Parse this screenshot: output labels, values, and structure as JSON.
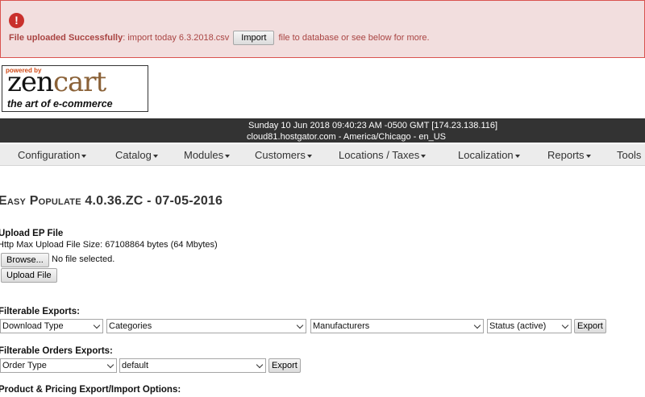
{
  "alert": {
    "bold": "File uploaded Successfully",
    "mid": ": import today 6.3.2018.csv",
    "button": "Import",
    "tail": "file to database or see below for more.",
    "icon": "exclamation-circle-icon",
    "color": "#a94442"
  },
  "logo": {
    "powered": "powered by",
    "zen": "zen",
    "cart": "cart",
    "tagline": "the art of e-commerce"
  },
  "header": {
    "datetime": "Sunday 10 Jun 2018 09:40:23 AM -0500 GMT [174.23.138.116]",
    "server": "cloud81.hostgator.com - America/Chicago - en_US"
  },
  "nav": [
    "Configuration",
    "Catalog",
    "Modules",
    "Customers",
    "Locations / Taxes",
    "Localization",
    "Reports",
    "Tools"
  ],
  "page": {
    "title": "Easy Populate 4.0.36.ZC - 07-05-2016",
    "upload_heading": "Upload EP File",
    "max_size": "Http Max Upload File Size: 67108864 bytes (64 Mbytes)",
    "browse": "Browse...",
    "no_file": "No file selected.",
    "upload_button": "Upload File"
  },
  "filterable_exports": {
    "label": "Filterable Exports:",
    "selects": [
      "Download Type",
      "Categories",
      "Manufacturers",
      "Status (active)"
    ],
    "button": "Export"
  },
  "orders_exports": {
    "label": "Filterable Orders Exports:",
    "selects": [
      "Order Type",
      "default"
    ],
    "button": "Export"
  },
  "product_pricing": {
    "label": "Product & Pricing Export/Import Options:"
  }
}
